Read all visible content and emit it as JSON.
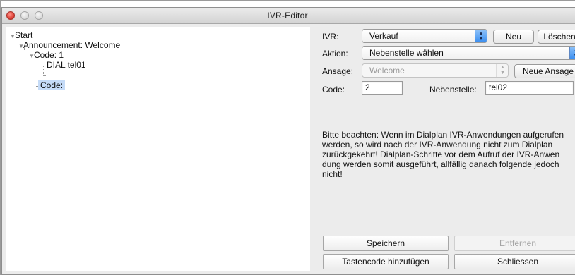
{
  "window": {
    "title": "IVR-Editor"
  },
  "tree": {
    "nodes": [
      {
        "label": "Start"
      },
      {
        "label": "Announcement: Welcome"
      },
      {
        "label": "Code: 1"
      },
      {
        "label": "DIAL tel01"
      },
      {
        "label": "Code:"
      }
    ]
  },
  "form": {
    "ivr": {
      "label": "IVR:",
      "value": "Verkauf",
      "new_button": "Neu",
      "delete_button": "Löschen"
    },
    "action": {
      "label": "Aktion:",
      "value": "Nebenstelle wählen"
    },
    "announcement": {
      "label": "Ansage:",
      "value": "Welcome",
      "new_button": "Neue Ansage"
    },
    "code": {
      "label": "Code:",
      "value": "2"
    },
    "extension": {
      "label": "Nebenstelle:",
      "value": "tel02"
    },
    "notice_lines": [
      "Bitte beachten: Wenn im Dialplan IVR-Anwendungen aufgerufen",
      "werden, so wird nach der IVR-Anwendung nicht zum Dialplan",
      "zurückgekehrt! Dialplan-Schritte vor dem Aufruf der IVR-Anwen",
      "dung werden somit ausgeführt, allfällig danach folgende jedoch",
      "nicht!"
    ]
  },
  "buttons": {
    "save": "Speichern",
    "remove": "Entfernen",
    "add_keycode": "Tastencode hinzufügen",
    "close": "Schliessen"
  }
}
